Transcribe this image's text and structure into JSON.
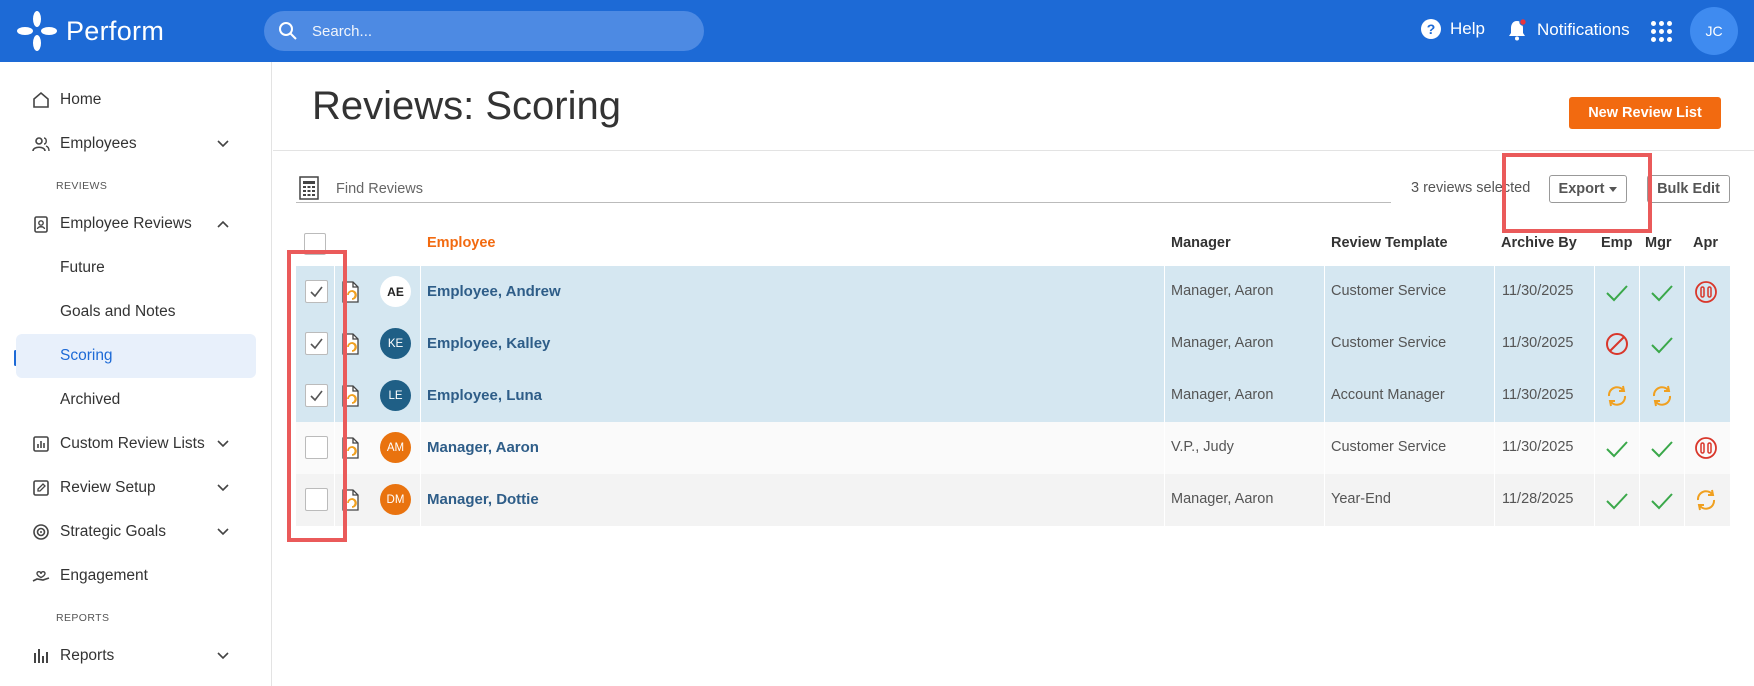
{
  "topbar": {
    "brand": "Perform",
    "search_placeholder": "Search...",
    "help_label": "Help",
    "notifications_label": "Notifications",
    "user_initials": "JC"
  },
  "sidebar": {
    "home": "Home",
    "employees": "Employees",
    "section_reviews": "REVIEWS",
    "employee_reviews": "Employee Reviews",
    "future": "Future",
    "goals_notes": "Goals and Notes",
    "scoring": "Scoring",
    "archived": "Archived",
    "custom_review_lists": "Custom Review Lists",
    "review_setup": "Review Setup",
    "strategic_goals": "Strategic Goals",
    "engagement": "Engagement",
    "section_reports": "REPORTS",
    "reports": "Reports"
  },
  "main": {
    "title": "Reviews: Scoring",
    "new_review_list": "New Review List",
    "find_placeholder": "Find Reviews",
    "selected_count": "3 reviews selected",
    "export_label": "Export",
    "bulk_edit_label": "Bulk Edit"
  },
  "table": {
    "headers": {
      "employee": "Employee",
      "manager": "Manager",
      "template": "Review Template",
      "archive_by": "Archive By",
      "emp": "Emp",
      "mgr": "Mgr",
      "apr": "Apr"
    },
    "rows": [
      {
        "checked": true,
        "initials": "AE",
        "employee": "Employee, Andrew",
        "manager": "Manager, Aaron",
        "template": "Customer Service",
        "archive_by": "11/30/2025",
        "emp": "check",
        "mgr": "check",
        "apr": "paused"
      },
      {
        "checked": true,
        "initials": "KE",
        "employee": "Employee, Kalley",
        "manager": "Manager, Aaron",
        "template": "Customer Service",
        "archive_by": "11/30/2025",
        "emp": "blocked",
        "mgr": "check",
        "apr": "none"
      },
      {
        "checked": true,
        "initials": "LE",
        "employee": "Employee, Luna",
        "manager": "Manager, Aaron",
        "template": "Account Manager",
        "archive_by": "11/30/2025",
        "emp": "in-progress",
        "mgr": "in-progress",
        "apr": "none"
      },
      {
        "checked": false,
        "initials": "AM",
        "employee": "Manager, Aaron",
        "manager": "V.P., Judy",
        "template": "Customer Service",
        "archive_by": "11/30/2025",
        "emp": "check",
        "mgr": "check",
        "apr": "paused"
      },
      {
        "checked": false,
        "initials": "DM",
        "employee": "Manager, Dottie",
        "manager": "Manager, Aaron",
        "template": "Year-End",
        "archive_by": "11/28/2025",
        "emp": "check",
        "mgr": "check",
        "apr": "in-progress"
      }
    ]
  },
  "colors": {
    "brand_blue": "#1d6ad6",
    "accent_orange": "#f26a10",
    "selected_row": "#d5e7f1",
    "check_green": "#3aa84a",
    "blocked_red": "#d9372b",
    "progress_amber": "#f0a020",
    "highlight_red": "#ea5a5a"
  }
}
